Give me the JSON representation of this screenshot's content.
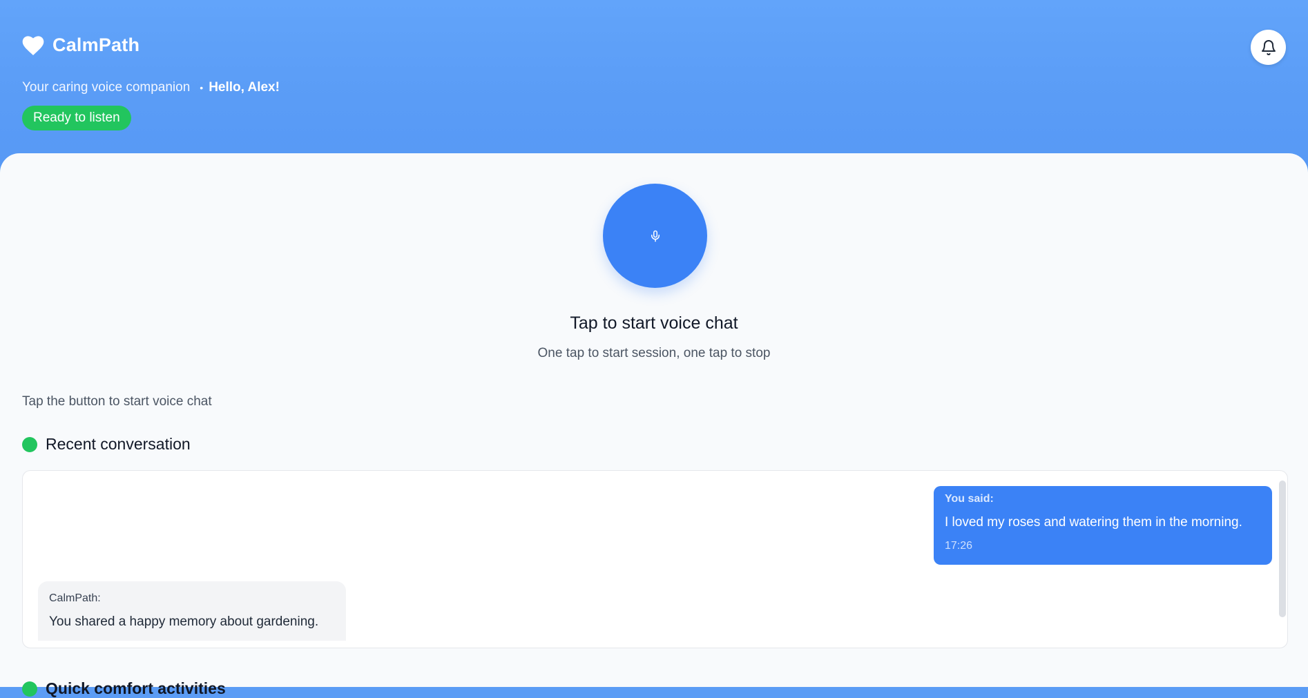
{
  "header": {
    "app_name": "CalmPath",
    "tagline": "Your caring voice companion",
    "separator": "•",
    "greeting": "Hello, Alex!",
    "status": "Ready to listen"
  },
  "voice": {
    "title": "Tap to start voice chat",
    "subtitle": "One tap to start session, one tap to stop",
    "hint": "Tap the button to start voice chat"
  },
  "recent": {
    "title": "Recent conversation",
    "messages": [
      {
        "sender": "You said:",
        "text": "I loved my roses and watering them in the morning.",
        "time": "17:26"
      },
      {
        "sender": "CalmPath:",
        "text": "You shared a happy memory about gardening."
      }
    ]
  },
  "next_section": {
    "title": "Quick comfort activities"
  },
  "colors": {
    "header_blue": "#5a9cf6",
    "accent_blue": "#3b82f6",
    "status_green": "#22c55e"
  },
  "icons": {
    "brand": "heart-icon",
    "notifications": "bell-icon",
    "voice": "microphone-icon"
  }
}
